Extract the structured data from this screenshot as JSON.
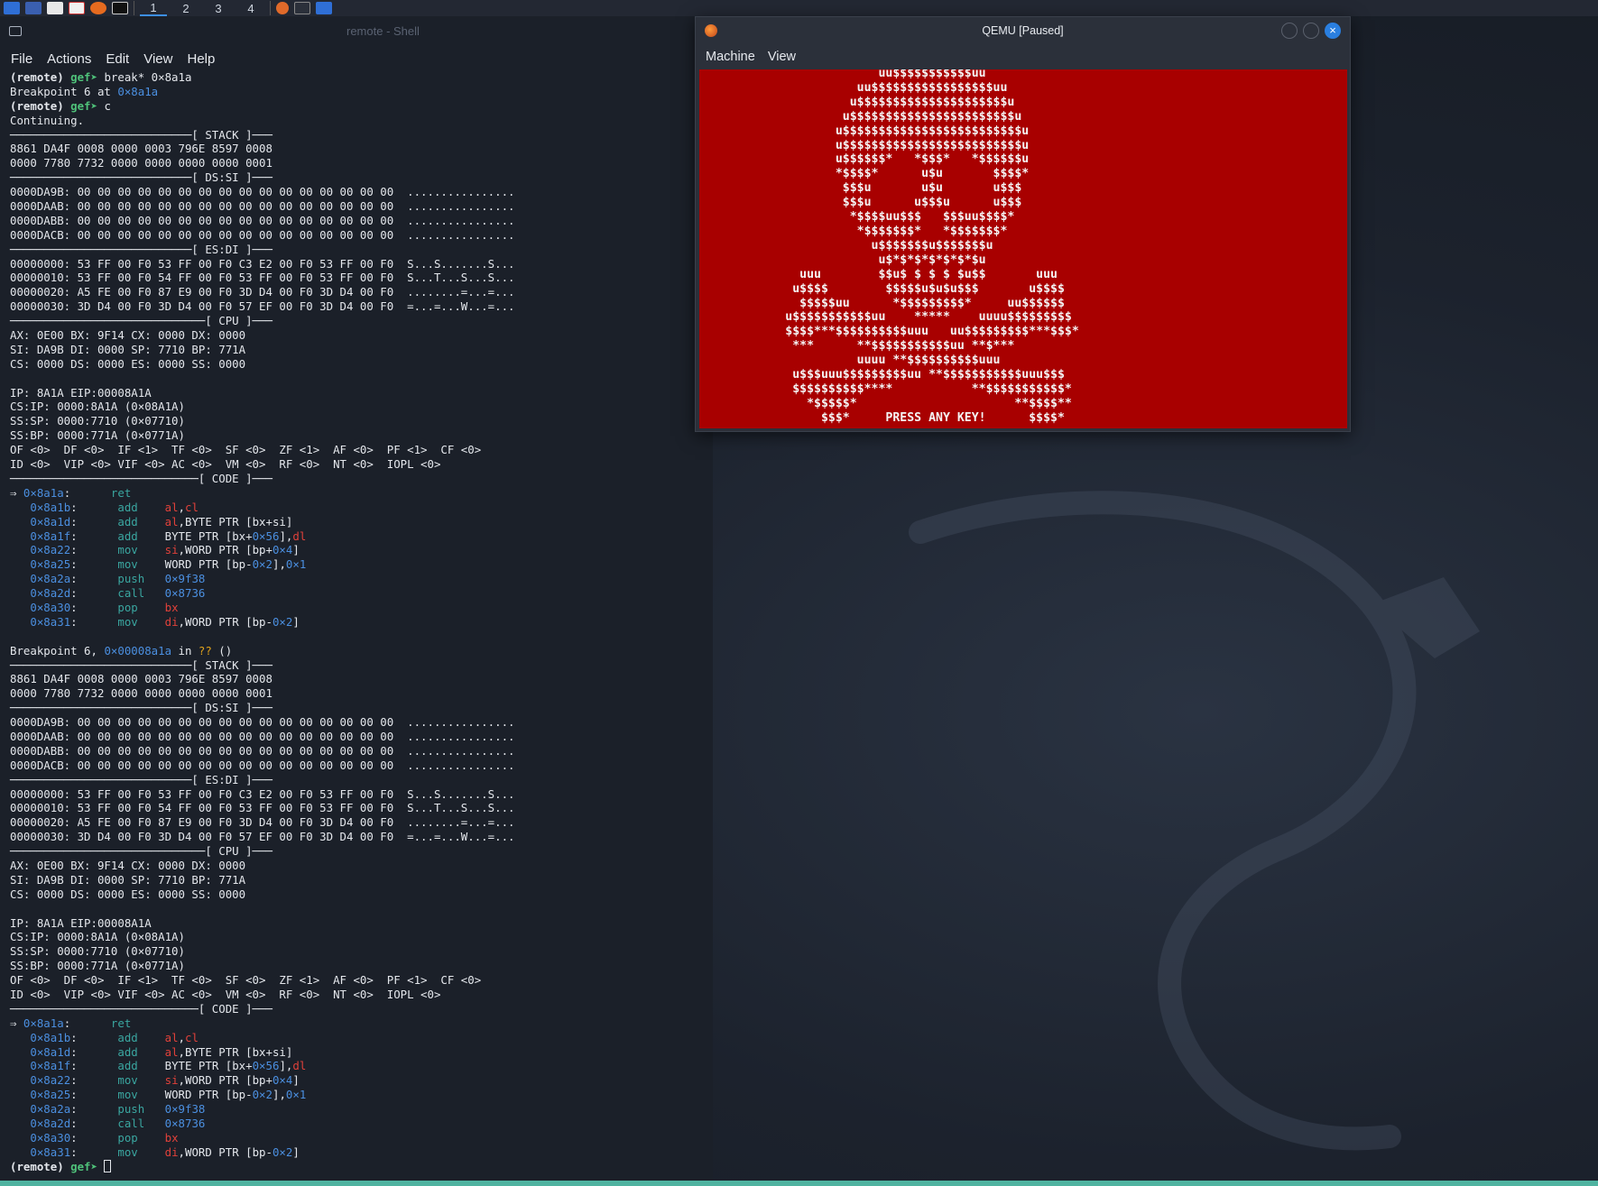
{
  "topbar": {
    "workspaces": [
      "1",
      "2",
      "3",
      "4"
    ],
    "accent": "#3d8fe8"
  },
  "terminal": {
    "title": "remote - Shell",
    "menu": [
      "File",
      "Actions",
      "Edit",
      "View",
      "Help"
    ],
    "lines": [
      [
        [
          "prompt-remote",
          "(remote) "
        ],
        [
          "prompt-gef",
          "gef➤ "
        ],
        [
          "",
          "break* 0×8a1a"
        ]
      ],
      [
        [
          "",
          "Breakpoint 6 at "
        ],
        [
          "hex",
          "0×8a1a"
        ]
      ],
      [
        [
          "prompt-remote",
          "(remote) "
        ],
        [
          "prompt-gef",
          "gef➤ "
        ],
        [
          "",
          "c"
        ]
      ],
      [
        [
          "",
          "Continuing."
        ]
      ],
      [
        [
          "",
          "───────────────────────────[ STACK ]───"
        ]
      ],
      [
        [
          "",
          "8861 DA4F 0008 0000 0003 796E 8597 0008"
        ]
      ],
      [
        [
          "",
          "0000 7780 7732 0000 0000 0000 0000 0001"
        ]
      ],
      [
        [
          "",
          "───────────────────────────[ DS:SI ]───"
        ]
      ],
      [
        [
          "",
          "0000DA9B: 00 00 00 00 00 00 00 00 00 00 00 00 00 00 00 00  ................"
        ]
      ],
      [
        [
          "",
          "0000DAAB: 00 00 00 00 00 00 00 00 00 00 00 00 00 00 00 00  ................"
        ]
      ],
      [
        [
          "",
          "0000DABB: 00 00 00 00 00 00 00 00 00 00 00 00 00 00 00 00  ................"
        ]
      ],
      [
        [
          "",
          "0000DACB: 00 00 00 00 00 00 00 00 00 00 00 00 00 00 00 00  ................"
        ]
      ],
      [
        [
          "",
          "───────────────────────────[ ES:DI ]───"
        ]
      ],
      [
        [
          "",
          "00000000: 53 FF 00 F0 53 FF 00 F0 C3 E2 00 F0 53 FF 00 F0  S...S.......S..."
        ]
      ],
      [
        [
          "",
          "00000010: 53 FF 00 F0 54 FF 00 F0 53 FF 00 F0 53 FF 00 F0  S...T...S...S..."
        ]
      ],
      [
        [
          "",
          "00000020: A5 FE 00 F0 87 E9 00 F0 3D D4 00 F0 3D D4 00 F0  ........=...=..."
        ]
      ],
      [
        [
          "",
          "00000030: 3D D4 00 F0 3D D4 00 F0 57 EF 00 F0 3D D4 00 F0  =...=...W...=..."
        ]
      ],
      [
        [
          "",
          "─────────────────────────────[ CPU ]───"
        ]
      ],
      [
        [
          "",
          "AX: 0E00 BX: 9F14 CX: 0000 DX: 0000"
        ]
      ],
      [
        [
          "",
          "SI: DA9B DI: 0000 SP: 7710 BP: 771A"
        ]
      ],
      [
        [
          "",
          "CS: 0000 DS: 0000 ES: 0000 SS: 0000"
        ]
      ],
      [
        [
          "",
          ""
        ]
      ],
      [
        [
          "",
          "IP: 8A1A EIP:00008A1A"
        ]
      ],
      [
        [
          "",
          "CS:IP: 0000:8A1A (0×08A1A)"
        ]
      ],
      [
        [
          "",
          "SS:SP: 0000:7710 (0×07710)"
        ]
      ],
      [
        [
          "",
          "SS:BP: 0000:771A (0×0771A)"
        ]
      ],
      [
        [
          "",
          "OF <0>  DF <0>  IF <1>  TF <0>  SF <0>  ZF <1>  AF <0>  PF <1>  CF <0>"
        ]
      ],
      [
        [
          "",
          "ID <0>  VIP <0> VIF <0> AC <0>  VM <0>  RF <0>  NT <0>  IOPL <0>"
        ]
      ],
      [
        [
          "",
          "────────────────────────────[ CODE ]───"
        ]
      ],
      [
        [
          "",
          "⇒ "
        ],
        [
          "addr",
          "0×8a1a"
        ],
        [
          "",
          ":      "
        ],
        [
          "mnem",
          "ret"
        ]
      ],
      [
        [
          "",
          "   "
        ],
        [
          "addr",
          "0×8a1b"
        ],
        [
          "",
          ":      "
        ],
        [
          "mnem",
          "add"
        ],
        [
          "",
          "    "
        ],
        [
          "reg",
          "al"
        ],
        [
          "",
          ","
        ],
        [
          "reg",
          "cl"
        ]
      ],
      [
        [
          "",
          "   "
        ],
        [
          "addr",
          "0×8a1d"
        ],
        [
          "",
          ":      "
        ],
        [
          "mnem",
          "add"
        ],
        [
          "",
          "    "
        ],
        [
          "reg",
          "al"
        ],
        [
          "",
          ",BYTE PTR [bx+si]"
        ]
      ],
      [
        [
          "",
          "   "
        ],
        [
          "addr",
          "0×8a1f"
        ],
        [
          "",
          ":      "
        ],
        [
          "mnem",
          "add"
        ],
        [
          "",
          "    BYTE PTR [bx+"
        ],
        [
          "hex",
          "0×56"
        ],
        [
          "",
          "],"
        ],
        [
          "reg",
          "dl"
        ]
      ],
      [
        [
          "",
          "   "
        ],
        [
          "addr",
          "0×8a22"
        ],
        [
          "",
          ":      "
        ],
        [
          "mnem",
          "mov"
        ],
        [
          "",
          "    "
        ],
        [
          "reg",
          "si"
        ],
        [
          "",
          ",WORD PTR [bp+"
        ],
        [
          "hex",
          "0×4"
        ],
        [
          "",
          "]"
        ]
      ],
      [
        [
          "",
          "   "
        ],
        [
          "addr",
          "0×8a25"
        ],
        [
          "",
          ":      "
        ],
        [
          "mnem",
          "mov"
        ],
        [
          "",
          "    WORD PTR [bp-"
        ],
        [
          "hex",
          "0×2"
        ],
        [
          "",
          "],"
        ],
        [
          "hex",
          "0×1"
        ]
      ],
      [
        [
          "",
          "   "
        ],
        [
          "addr",
          "0×8a2a"
        ],
        [
          "",
          ":      "
        ],
        [
          "mnem",
          "push"
        ],
        [
          "",
          "   "
        ],
        [
          "hex",
          "0×9f38"
        ]
      ],
      [
        [
          "",
          "   "
        ],
        [
          "addr",
          "0×8a2d"
        ],
        [
          "",
          ":      "
        ],
        [
          "mnem",
          "call"
        ],
        [
          "",
          "   "
        ],
        [
          "hex",
          "0×8736"
        ]
      ],
      [
        [
          "",
          "   "
        ],
        [
          "addr",
          "0×8a30"
        ],
        [
          "",
          ":      "
        ],
        [
          "mnem",
          "pop"
        ],
        [
          "",
          "    "
        ],
        [
          "reg",
          "bx"
        ]
      ],
      [
        [
          "",
          "   "
        ],
        [
          "addr",
          "0×8a31"
        ],
        [
          "",
          ":      "
        ],
        [
          "mnem",
          "mov"
        ],
        [
          "",
          "    "
        ],
        [
          "reg",
          "di"
        ],
        [
          "",
          ",WORD PTR [bp-"
        ],
        [
          "hex",
          "0×2"
        ],
        [
          "",
          "]"
        ]
      ],
      [
        [
          "",
          ""
        ]
      ],
      [
        [
          "",
          "Breakpoint 6, "
        ],
        [
          "hex",
          "0×00008a1a"
        ],
        [
          "",
          " in "
        ],
        [
          "qq",
          "??"
        ],
        [
          "",
          " ()"
        ]
      ],
      [
        [
          "",
          "───────────────────────────[ STACK ]───"
        ]
      ],
      [
        [
          "",
          "8861 DA4F 0008 0000 0003 796E 8597 0008"
        ]
      ],
      [
        [
          "",
          "0000 7780 7732 0000 0000 0000 0000 0001"
        ]
      ],
      [
        [
          "",
          "───────────────────────────[ DS:SI ]───"
        ]
      ],
      [
        [
          "",
          "0000DA9B: 00 00 00 00 00 00 00 00 00 00 00 00 00 00 00 00  ................"
        ]
      ],
      [
        [
          "",
          "0000DAAB: 00 00 00 00 00 00 00 00 00 00 00 00 00 00 00 00  ................"
        ]
      ],
      [
        [
          "",
          "0000DABB: 00 00 00 00 00 00 00 00 00 00 00 00 00 00 00 00  ................"
        ]
      ],
      [
        [
          "",
          "0000DACB: 00 00 00 00 00 00 00 00 00 00 00 00 00 00 00 00  ................"
        ]
      ],
      [
        [
          "",
          "───────────────────────────[ ES:DI ]───"
        ]
      ],
      [
        [
          "",
          "00000000: 53 FF 00 F0 53 FF 00 F0 C3 E2 00 F0 53 FF 00 F0  S...S.......S..."
        ]
      ],
      [
        [
          "",
          "00000010: 53 FF 00 F0 54 FF 00 F0 53 FF 00 F0 53 FF 00 F0  S...T...S...S..."
        ]
      ],
      [
        [
          "",
          "00000020: A5 FE 00 F0 87 E9 00 F0 3D D4 00 F0 3D D4 00 F0  ........=...=..."
        ]
      ],
      [
        [
          "",
          "00000030: 3D D4 00 F0 3D D4 00 F0 57 EF 00 F0 3D D4 00 F0  =...=...W...=..."
        ]
      ],
      [
        [
          "",
          "─────────────────────────────[ CPU ]───"
        ]
      ],
      [
        [
          "",
          "AX: 0E00 BX: 9F14 CX: 0000 DX: 0000"
        ]
      ],
      [
        [
          "",
          "SI: DA9B DI: 0000 SP: 7710 BP: 771A"
        ]
      ],
      [
        [
          "",
          "CS: 0000 DS: 0000 ES: 0000 SS: 0000"
        ]
      ],
      [
        [
          "",
          ""
        ]
      ],
      [
        [
          "",
          "IP: 8A1A EIP:00008A1A"
        ]
      ],
      [
        [
          "",
          "CS:IP: 0000:8A1A (0×08A1A)"
        ]
      ],
      [
        [
          "",
          "SS:SP: 0000:7710 (0×07710)"
        ]
      ],
      [
        [
          "",
          "SS:BP: 0000:771A (0×0771A)"
        ]
      ],
      [
        [
          "",
          "OF <0>  DF <0>  IF <1>  TF <0>  SF <0>  ZF <1>  AF <0>  PF <1>  CF <0>"
        ]
      ],
      [
        [
          "",
          "ID <0>  VIP <0> VIF <0> AC <0>  VM <0>  RF <0>  NT <0>  IOPL <0>"
        ]
      ],
      [
        [
          "",
          "────────────────────────────[ CODE ]───"
        ]
      ],
      [
        [
          "",
          "⇒ "
        ],
        [
          "addr",
          "0×8a1a"
        ],
        [
          "",
          ":      "
        ],
        [
          "mnem",
          "ret"
        ]
      ],
      [
        [
          "",
          "   "
        ],
        [
          "addr",
          "0×8a1b"
        ],
        [
          "",
          ":      "
        ],
        [
          "mnem",
          "add"
        ],
        [
          "",
          "    "
        ],
        [
          "reg",
          "al"
        ],
        [
          "",
          ","
        ],
        [
          "reg",
          "cl"
        ]
      ],
      [
        [
          "",
          "   "
        ],
        [
          "addr",
          "0×8a1d"
        ],
        [
          "",
          ":      "
        ],
        [
          "mnem",
          "add"
        ],
        [
          "",
          "    "
        ],
        [
          "reg",
          "al"
        ],
        [
          "",
          ",BYTE PTR [bx+si]"
        ]
      ],
      [
        [
          "",
          "   "
        ],
        [
          "addr",
          "0×8a1f"
        ],
        [
          "",
          ":      "
        ],
        [
          "mnem",
          "add"
        ],
        [
          "",
          "    BYTE PTR [bx+"
        ],
        [
          "hex",
          "0×56"
        ],
        [
          "",
          "],"
        ],
        [
          "reg",
          "dl"
        ]
      ],
      [
        [
          "",
          "   "
        ],
        [
          "addr",
          "0×8a22"
        ],
        [
          "",
          ":      "
        ],
        [
          "mnem",
          "mov"
        ],
        [
          "",
          "    "
        ],
        [
          "reg",
          "si"
        ],
        [
          "",
          ",WORD PTR [bp+"
        ],
        [
          "hex",
          "0×4"
        ],
        [
          "",
          "]"
        ]
      ],
      [
        [
          "",
          "   "
        ],
        [
          "addr",
          "0×8a25"
        ],
        [
          "",
          ":      "
        ],
        [
          "mnem",
          "mov"
        ],
        [
          "",
          "    WORD PTR [bp-"
        ],
        [
          "hex",
          "0×2"
        ],
        [
          "",
          "],"
        ],
        [
          "hex",
          "0×1"
        ]
      ],
      [
        [
          "",
          "   "
        ],
        [
          "addr",
          "0×8a2a"
        ],
        [
          "",
          ":      "
        ],
        [
          "mnem",
          "push"
        ],
        [
          "",
          "   "
        ],
        [
          "hex",
          "0×9f38"
        ]
      ],
      [
        [
          "",
          "   "
        ],
        [
          "addr",
          "0×8a2d"
        ],
        [
          "",
          ":      "
        ],
        [
          "mnem",
          "call"
        ],
        [
          "",
          "   "
        ],
        [
          "hex",
          "0×8736"
        ]
      ],
      [
        [
          "",
          "   "
        ],
        [
          "addr",
          "0×8a30"
        ],
        [
          "",
          ":      "
        ],
        [
          "mnem",
          "pop"
        ],
        [
          "",
          "    "
        ],
        [
          "reg",
          "bx"
        ]
      ],
      [
        [
          "",
          "   "
        ],
        [
          "addr",
          "0×8a31"
        ],
        [
          "",
          ":      "
        ],
        [
          "mnem",
          "mov"
        ],
        [
          "",
          "    "
        ],
        [
          "reg",
          "di"
        ],
        [
          "",
          ",WORD PTR [bp-"
        ],
        [
          "hex",
          "0×2"
        ],
        [
          "",
          "]"
        ]
      ]
    ],
    "prompt": {
      "remote": "(remote) ",
      "gef": "gef➤ "
    }
  },
  "qemu": {
    "title": "QEMU [Paused]",
    "menu": [
      "Machine",
      "View"
    ],
    "screen_color": "#a80000",
    "screen_lines": [
      "                         uu$$$$$$$$$$$uu",
      "                      uu$$$$$$$$$$$$$$$$$uu",
      "                     u$$$$$$$$$$$$$$$$$$$$$u",
      "                    u$$$$$$$$$$$$$$$$$$$$$$$u",
      "                   u$$$$$$$$$$$$$$$$$$$$$$$$$u",
      "                   u$$$$$$$$$$$$$$$$$$$$$$$$$u",
      "                   u$$$$$$*   *$$$*   *$$$$$$u",
      "                   *$$$$*      u$u       $$$$*",
      "                    $$$u       u$u       u$$$",
      "                    $$$u      u$$$u      u$$$",
      "                     *$$$$uu$$$   $$$uu$$$$*",
      "                      *$$$$$$$*   *$$$$$$$*",
      "                        u$$$$$$$u$$$$$$$u",
      "                         u$*$*$*$*$*$*$u",
      "              uuu        $$u$ $ $ $ $u$$       uuu",
      "             u$$$$        $$$$$u$u$u$$$       u$$$$",
      "              $$$$$uu      *$$$$$$$$$*     uu$$$$$$",
      "            u$$$$$$$$$$$uu    *****    uuuu$$$$$$$$$",
      "            $$$$***$$$$$$$$$$uuu   uu$$$$$$$$$***$$$*",
      "             ***      **$$$$$$$$$$$uu **$***",
      "                      uuuu **$$$$$$$$$$uuu",
      "             u$$$uuu$$$$$$$$$uu **$$$$$$$$$$$uuu$$$",
      "             $$$$$$$$$$****           **$$$$$$$$$$$*",
      "               *$$$$$*                      **$$$$**",
      "                 $$$*     PRESS ANY KEY!      $$$$*"
    ]
  }
}
